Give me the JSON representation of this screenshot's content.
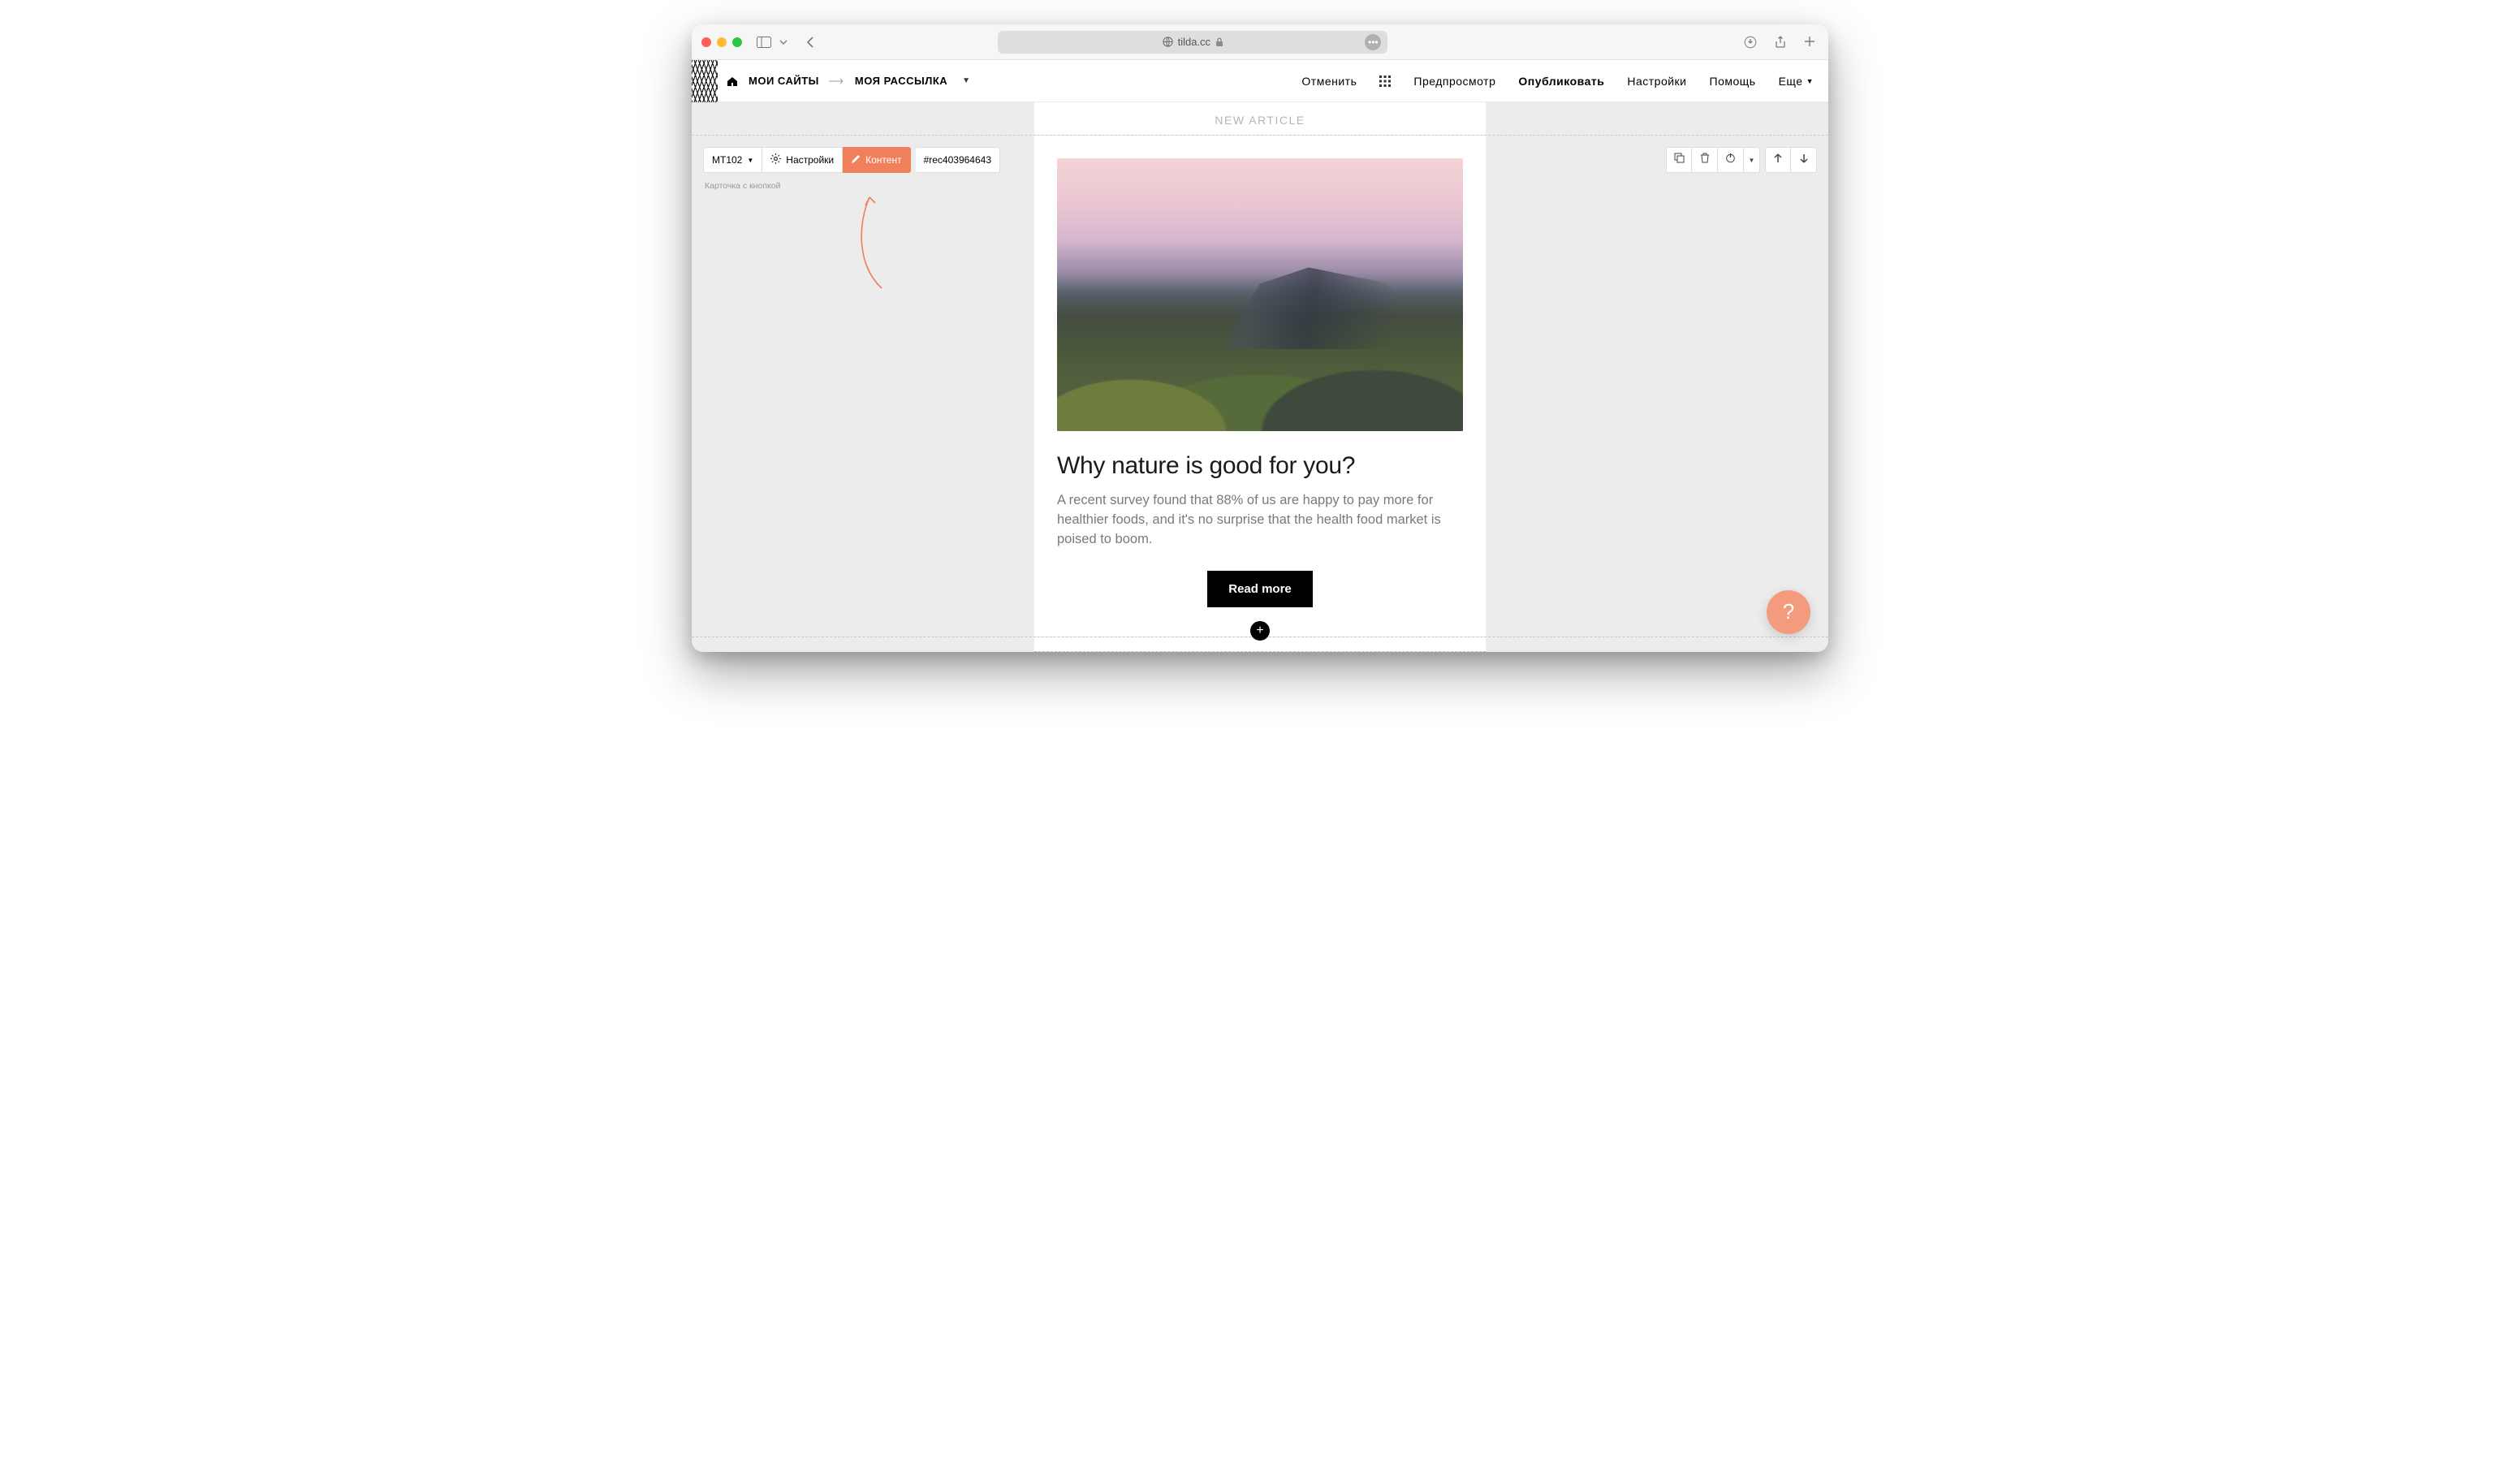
{
  "browser": {
    "url": "tilda.cc"
  },
  "header": {
    "breadcrumb": {
      "home": "МОИ САЙТЫ",
      "page": "МОЯ РАССЫЛКА"
    },
    "actions": {
      "undo": "Отменить",
      "preview": "Предпросмотр",
      "publish": "Опубликовать",
      "settings": "Настройки",
      "help": "Помощь",
      "more": "Еще"
    }
  },
  "canvas": {
    "section_title": "NEW ARTICLE"
  },
  "block": {
    "code": "MT102",
    "settings_label": "Настройки",
    "content_label": "Контент",
    "rec_id": "#rec403964643",
    "caption": "Карточка с кнопкой"
  },
  "card": {
    "title": "Why nature is good for you?",
    "description": "A recent survey found that 88% of us are happy to pay more for healthier foods, and it's no surprise that the health food market is poised to boom.",
    "button": "Read more"
  },
  "help_bubble": "?"
}
